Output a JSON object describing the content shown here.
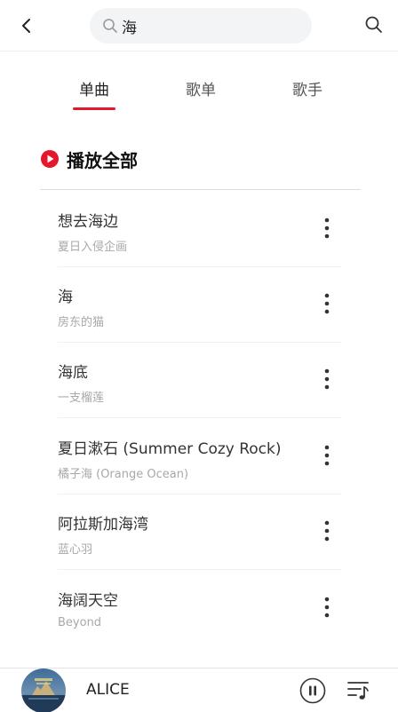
{
  "search": {
    "query": "海"
  },
  "tabs": [
    {
      "label": "单曲",
      "active": true
    },
    {
      "label": "歌单",
      "active": false
    },
    {
      "label": "歌手",
      "active": false
    }
  ],
  "play_all": {
    "label": "播放全部"
  },
  "songs": [
    {
      "title": "想去海边",
      "artist": "夏日入侵企画"
    },
    {
      "title": "海",
      "artist": "房东的猫"
    },
    {
      "title": "海底",
      "artist": "一支榴莲"
    },
    {
      "title": "夏日漱石 (Summer Cozy Rock)",
      "artist": "橘子海 (Orange Ocean)"
    },
    {
      "title": "阿拉斯加海湾",
      "artist": "蓝心羽"
    },
    {
      "title": "海阔天空",
      "artist": "Beyond"
    }
  ],
  "player": {
    "title": "ALICE",
    "state": "playing"
  },
  "colors": {
    "accent": "#e5172a",
    "text_primary": "#222222",
    "text_secondary": "#a8a8a8",
    "search_bg": "#f3f4f6"
  },
  "icons": {
    "back": "chevron-left-icon",
    "search": "search-icon",
    "play_all": "play-circle-icon",
    "more": "more-vertical-icon",
    "pause": "pause-circle-icon",
    "playlist": "playlist-icon"
  }
}
